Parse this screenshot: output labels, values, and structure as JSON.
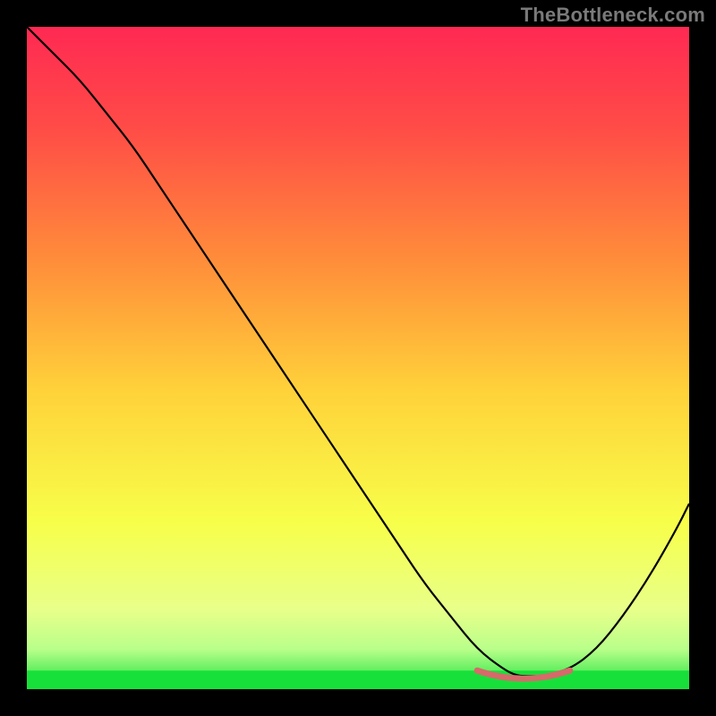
{
  "watermark": "TheBottleneck.com",
  "colors": {
    "background": "#000000",
    "curve_stroke": "#000000",
    "trough_stroke": "#d66a6a",
    "green_band": "#18e03a",
    "watermark_text": "#7a7a7a"
  },
  "chart_data": {
    "type": "line",
    "title": "",
    "xlabel": "",
    "ylabel": "",
    "xlim": [
      0,
      100
    ],
    "ylim": [
      0,
      100
    ],
    "grid": false,
    "legend": false,
    "gradient_stops": [
      {
        "offset": 0.0,
        "color": "#ff2953"
      },
      {
        "offset": 0.15,
        "color": "#ff4b47"
      },
      {
        "offset": 0.35,
        "color": "#ff8c3a"
      },
      {
        "offset": 0.55,
        "color": "#ffd23a"
      },
      {
        "offset": 0.75,
        "color": "#f7ff4a"
      },
      {
        "offset": 0.88,
        "color": "#e8ff8a"
      },
      {
        "offset": 0.94,
        "color": "#b8ff8a"
      },
      {
        "offset": 1.0,
        "color": "#18e03a"
      }
    ],
    "series": [
      {
        "name": "bottleneck-curve",
        "x": [
          0,
          4,
          8,
          12,
          16,
          20,
          24,
          28,
          32,
          36,
          40,
          44,
          48,
          52,
          56,
          60,
          64,
          68,
          72,
          74,
          76,
          78,
          82,
          86,
          90,
          94,
          98,
          100
        ],
        "y": [
          100,
          96,
          92,
          87,
          82,
          76,
          70,
          64,
          58,
          52,
          46,
          40,
          34,
          28,
          22,
          16,
          11,
          6,
          3,
          2,
          2,
          2,
          3,
          6,
          11,
          17,
          24,
          28
        ]
      }
    ],
    "trough_highlight": {
      "x_start": 68,
      "x_end": 82,
      "y": 2
    }
  }
}
